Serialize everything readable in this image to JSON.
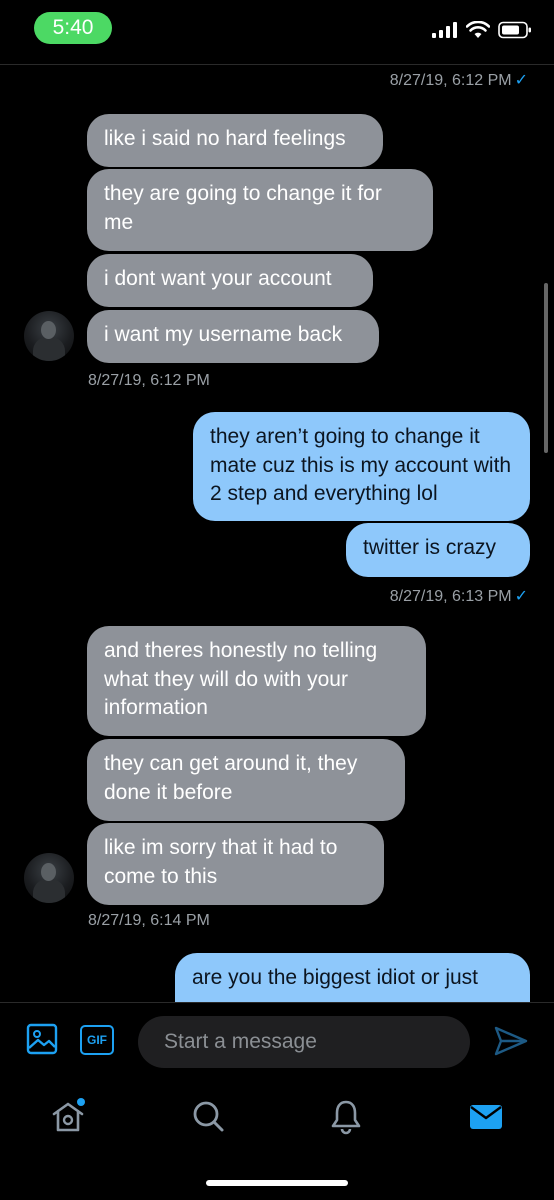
{
  "status_bar": {
    "time": "5:40"
  },
  "colors": {
    "accent": "#1da1f2",
    "incoming": "#8e9299",
    "outgoing": "#8ec8fb",
    "time_pill": "#4cd964"
  },
  "messages": {
    "ts1": "8/27/19, 6:12 PM",
    "m1": "like i said no hard feelings",
    "m2": "they are going to change it for me",
    "m3": "i dont want your account",
    "m4": "i want my username back",
    "ts2": "8/27/19, 6:12 PM",
    "m5": "they aren’t going to change it mate cuz this is my account with 2 step and everything lol",
    "m6": "twitter is crazy",
    "ts3": "8/27/19, 6:13 PM",
    "m7": "and theres honestly no telling what they will do with your information",
    "m8": "they can get around it, they done it before",
    "m9": "like im sorry that it had to come to this",
    "ts4": "8/27/19, 6:14 PM",
    "m10": "are you the biggest idiot or just"
  },
  "read_check": "✓",
  "composer": {
    "gif_label": "GIF",
    "placeholder": "Start a message"
  },
  "tabs": [
    "home-icon",
    "search-icon",
    "notifications-icon",
    "messages-icon"
  ]
}
